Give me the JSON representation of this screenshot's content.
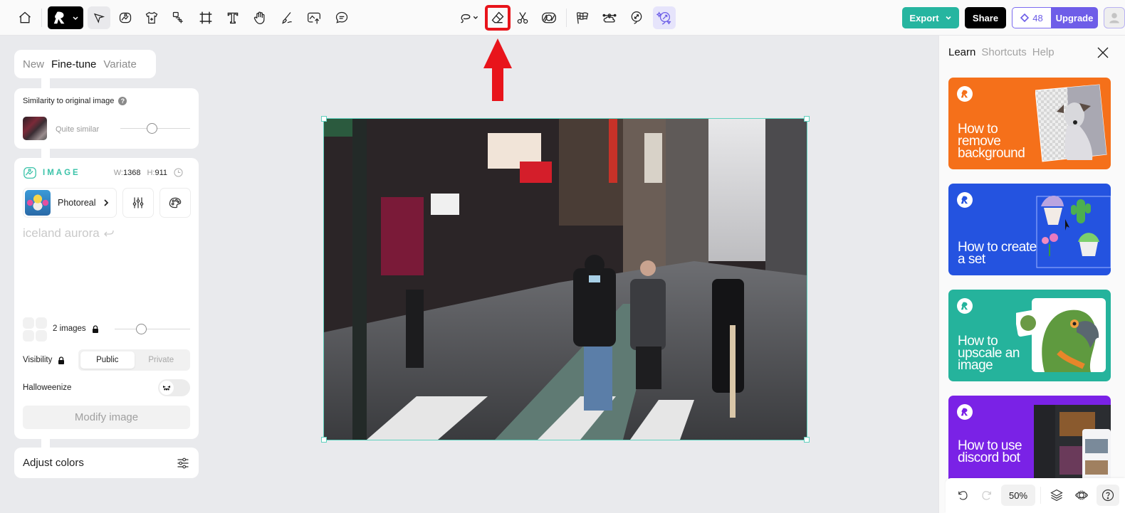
{
  "topbar": {
    "tools": [
      {
        "name": "home",
        "icon": "home-icon"
      },
      {
        "name": "select",
        "icon": "cursor-arrow-icon",
        "active": true
      },
      {
        "name": "generate-image",
        "icon": "image-generate-icon"
      },
      {
        "name": "merch",
        "icon": "tshirt-icon"
      },
      {
        "name": "layers-stack",
        "icon": "stack-icon"
      },
      {
        "name": "crop",
        "icon": "crop-icon"
      },
      {
        "name": "text",
        "icon": "text-icon"
      },
      {
        "name": "hand",
        "icon": "hand-icon"
      },
      {
        "name": "draw",
        "icon": "brush-icon"
      },
      {
        "name": "upload",
        "icon": "upload-icon"
      },
      {
        "name": "comment",
        "icon": "comment-icon"
      },
      {
        "name": "lasso",
        "icon": "lasso-icon"
      },
      {
        "name": "erase",
        "icon": "eraser-icon",
        "highlighted": true
      },
      {
        "name": "cut",
        "icon": "scissors-icon"
      },
      {
        "name": "remove-bg",
        "icon": "mask-icon"
      },
      {
        "name": "flags",
        "icon": "checkered-flag-icon"
      },
      {
        "name": "vector",
        "icon": "vector-cloud-icon"
      },
      {
        "name": "upscale",
        "icon": "upscale-balloon-icon"
      },
      {
        "name": "magic",
        "icon": "magic-upscale-icon",
        "accent": true
      }
    ],
    "export_label": "Export",
    "share_label": "Share",
    "credits": "48",
    "upgrade_label": "Upgrade",
    "colors": {
      "export": "#26b5a0",
      "upgrade": "#6e5de8",
      "highlight": "#e8141b"
    }
  },
  "left_panel": {
    "mode_tabs": [
      {
        "label": "New",
        "active": false
      },
      {
        "label": "Fine-tune",
        "active": true
      },
      {
        "label": "Variate",
        "active": false
      }
    ],
    "similarity": {
      "title": "Similarity to original image",
      "help": "?",
      "value_label": "Quite similar",
      "value_fraction": 0.45
    },
    "image": {
      "section_label": "IMAGE",
      "width_key": "W:",
      "width": "1368",
      "height_key": "H:",
      "height": "911",
      "model": "Photoreal",
      "prompt": "iceland aurora",
      "image_count": "2 images",
      "image_count_fraction": 0.35,
      "visibility_label": "Visibility",
      "visibility_options": [
        "Public",
        "Private"
      ],
      "visibility_selected": "Public",
      "halloweenize_label": "Halloweenize",
      "halloweenize_on": false,
      "modify_label": "Modify image"
    },
    "adjust_colors_label": "Adjust colors"
  },
  "learn_panel": {
    "tabs": [
      {
        "label": "Learn",
        "active": true
      },
      {
        "label": "Shortcuts",
        "active": false
      },
      {
        "label": "Help",
        "active": false
      }
    ],
    "cards": [
      {
        "title": "How to remove background",
        "color": "#f5701a"
      },
      {
        "title": "How to create a set",
        "color": "#2453e0"
      },
      {
        "title": "How to upscale an image",
        "color": "#25b39c"
      },
      {
        "title": "How to use discord bot",
        "color": "#7a22e6"
      }
    ]
  },
  "bottom_bar": {
    "zoom": "50%"
  }
}
